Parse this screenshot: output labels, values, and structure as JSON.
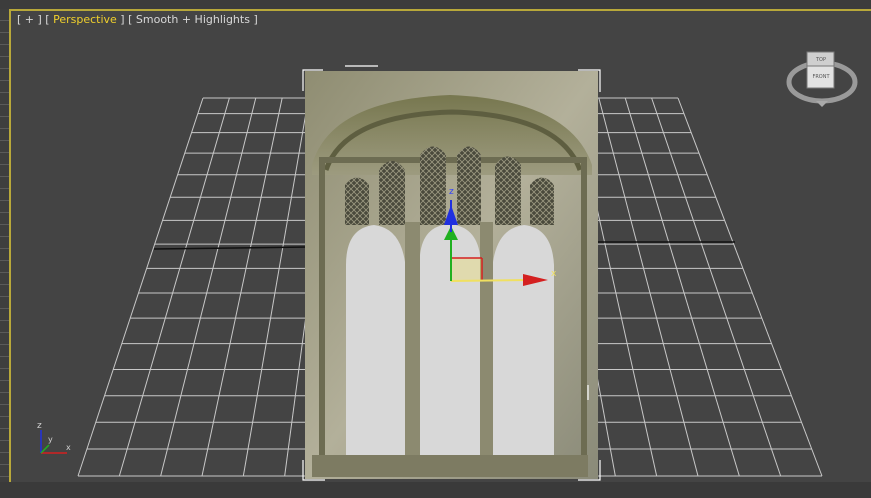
{
  "viewport": {
    "label": {
      "plus": "[ + ]",
      "view_open": "[ ",
      "view_name": "Perspective",
      "view_close": " ]",
      "shading": "[ Smooth + Highlights ]"
    },
    "viewcube": {
      "top_face": "TOP",
      "front_face": "FRONT"
    },
    "axis_triad": {
      "z": "z",
      "x": "x",
      "y": "y"
    }
  },
  "colors": {
    "viewport_bg": "#444444",
    "grid": "#c8c8c8",
    "active_border": "#b8a83a",
    "label_active": "#f0d02c",
    "gizmo_x": "#d42020",
    "gizmo_y": "#20b020",
    "gizmo_z": "#2030e0",
    "gizmo_plane": "#f0e060"
  },
  "object": {
    "type": "textured-plane",
    "icon": "gothic-window-texture"
  }
}
